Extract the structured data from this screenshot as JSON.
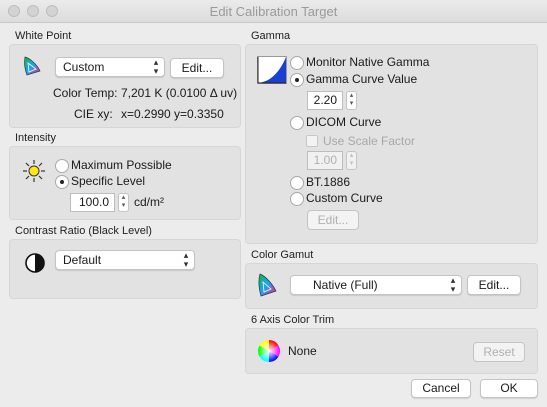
{
  "window": {
    "title": "Edit Calibration Target"
  },
  "white_point": {
    "section_title": "White Point",
    "preset_value": "Custom",
    "edit_label": "Edit...",
    "color_temp_label": "Color Temp:",
    "color_temp_value": "7,201 K (0.0100 Δ uv)",
    "cie_label": "CIE xy:",
    "cie_value": "x=0.2990 y=0.3350"
  },
  "intensity": {
    "section_title": "Intensity",
    "option_max": "Maximum Possible",
    "option_specific": "Specific Level",
    "selected": "Specific Level",
    "level_value": "100.0",
    "unit": "cd/m²"
  },
  "contrast": {
    "section_title": "Contrast Ratio (Black Level)",
    "value": "Default"
  },
  "gamma": {
    "section_title": "Gamma",
    "option_native": "Monitor Native Gamma",
    "option_curve_value": "Gamma Curve Value",
    "curve_value": "2.20",
    "option_dicom": "DICOM Curve",
    "use_scale_factor_label": "Use Scale Factor",
    "scale_factor_value": "1.00",
    "option_bt1886": "BT.1886",
    "option_custom": "Custom Curve",
    "custom_edit_label": "Edit...",
    "selected": "Gamma Curve Value"
  },
  "color_gamut": {
    "section_title": "Color Gamut",
    "value": "Native (Full)",
    "edit_label": "Edit..."
  },
  "color_trim": {
    "section_title": "6 Axis Color Trim",
    "status": "None",
    "reset_label": "Reset"
  },
  "footer": {
    "cancel_label": "Cancel",
    "ok_label": "OK"
  },
  "icons": {
    "white_point": "cie-chromaticity-icon",
    "intensity": "sun-icon",
    "contrast": "contrast-icon",
    "gamma": "gamma-curve-icon",
    "gamut": "cie-chromaticity-icon",
    "trim": "color-wheel-icon"
  }
}
